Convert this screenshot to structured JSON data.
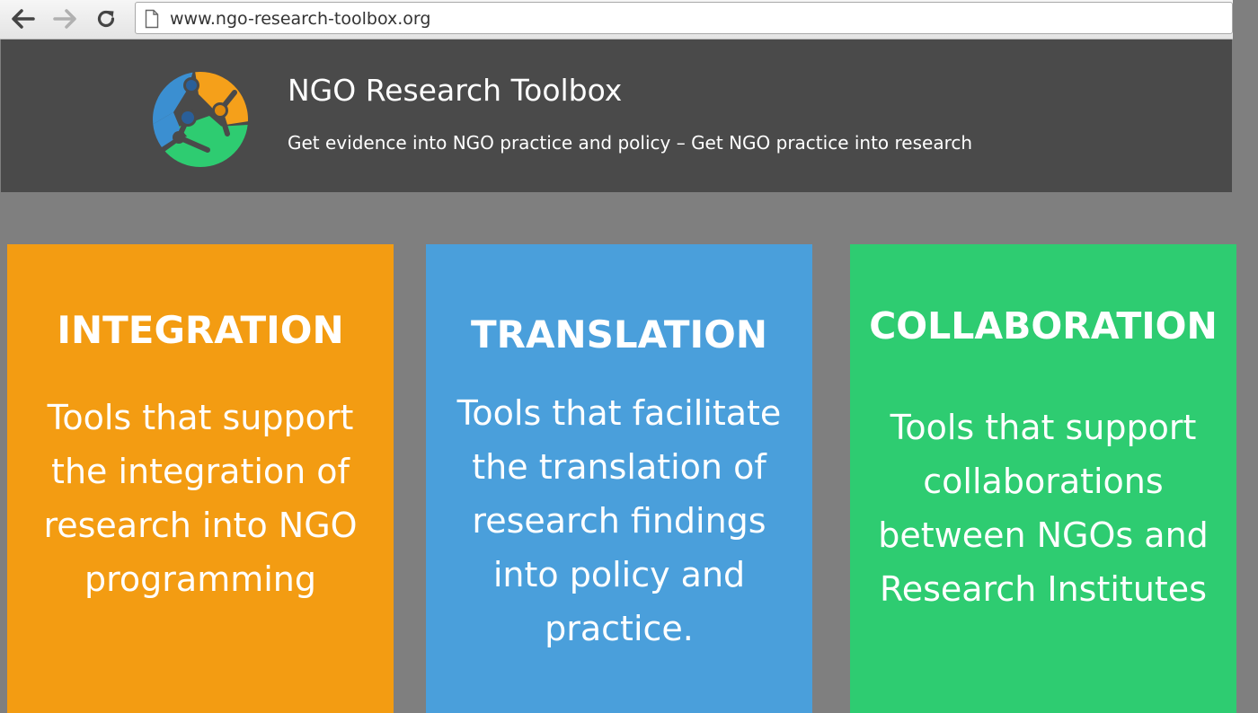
{
  "browser": {
    "url": "www.ngo-research-toolbox.org",
    "back_icon": "arrow-left-icon",
    "forward_icon": "arrow-right-icon",
    "reload_icon": "reload-icon",
    "page_icon": "document-icon"
  },
  "header": {
    "title": "NGO Research Toolbox",
    "tagline": "Get evidence into NGO practice and policy – Get NGO practice into research",
    "logo_colors": [
      "#3b8fd1",
      "#f5a01a",
      "#2ecc71",
      "#2a5f99"
    ]
  },
  "cards": [
    {
      "title": "INTEGRATION",
      "description": "Tools that support\nthe integration of\nresearch into NGO\nprogramming",
      "color": "#f39c12"
    },
    {
      "title": "TRANSLATION",
      "description": "Tools that facilitate\nthe translation of\nresearch findings\ninto policy and\npractice.",
      "color": "#4a9fdb"
    },
    {
      "title": "COLLABORATION",
      "description": "Tools that support\ncollaborations\nbetween NGOs and\nResearch Institutes",
      "color": "#2ecc71"
    }
  ]
}
